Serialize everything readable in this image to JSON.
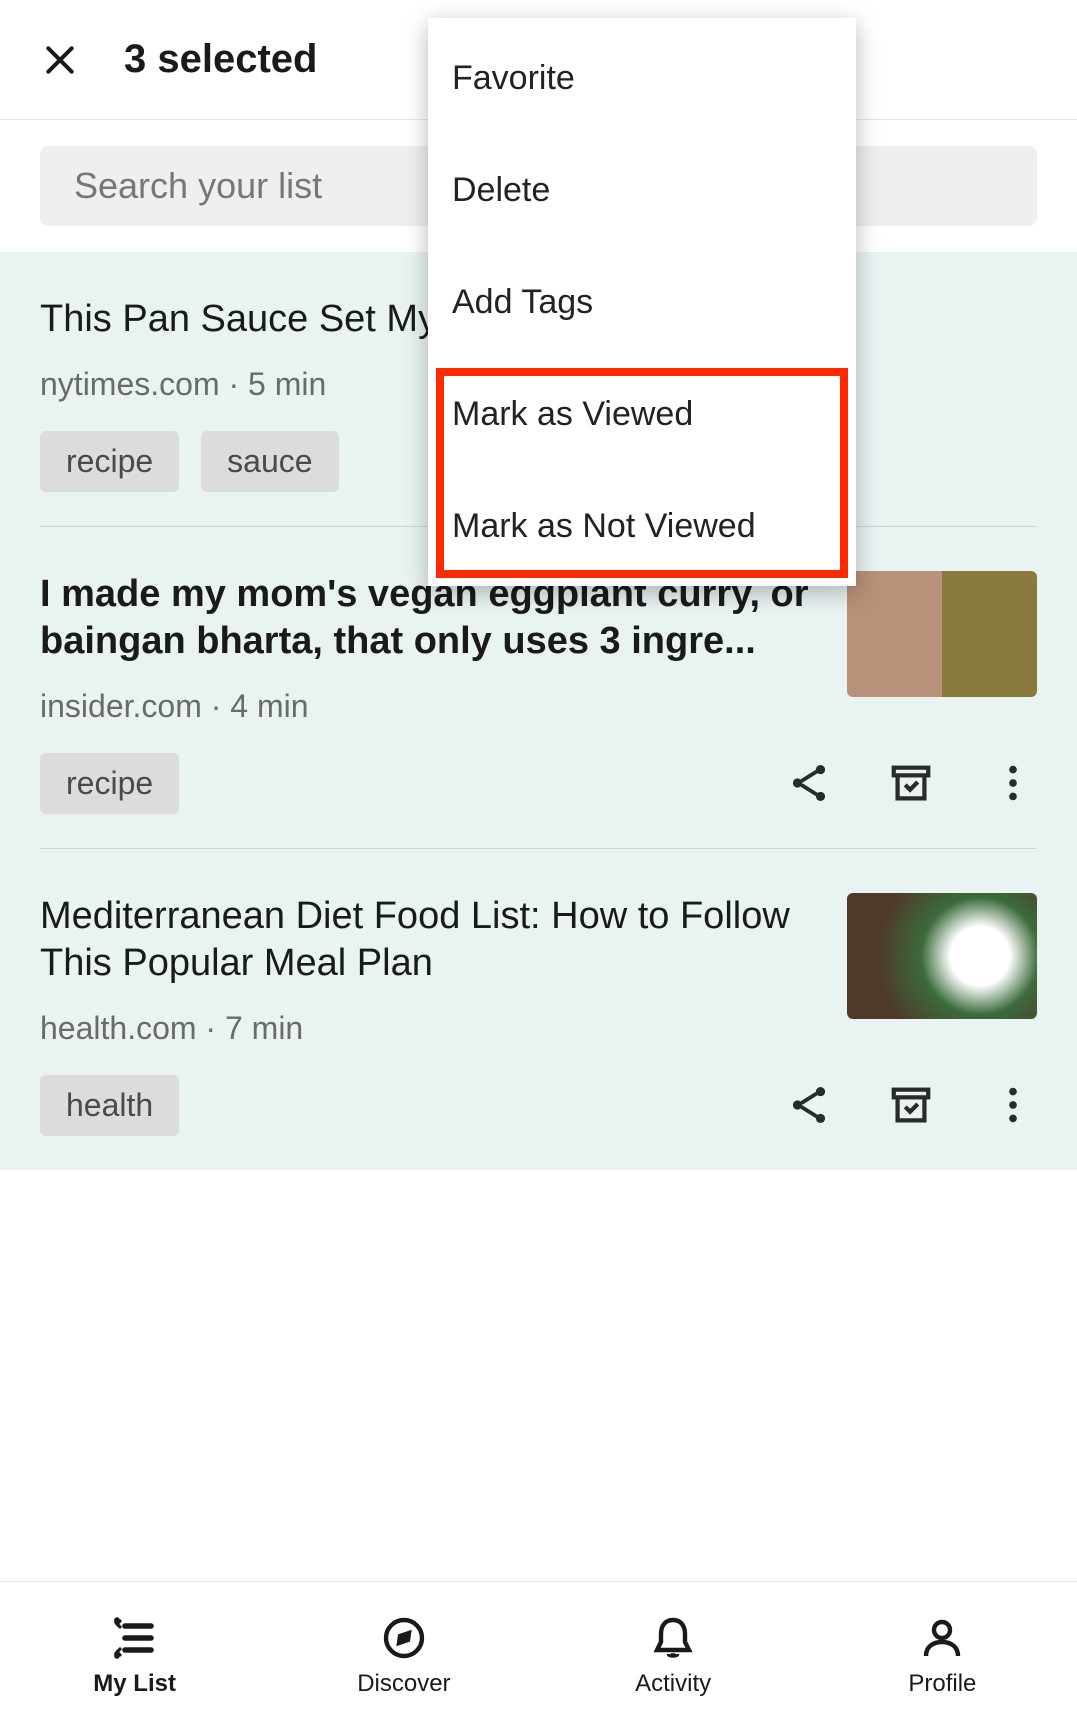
{
  "header": {
    "title": "3 selected"
  },
  "search": {
    "placeholder": "Search your list"
  },
  "menu": {
    "items": [
      {
        "label": "Favorite"
      },
      {
        "label": "Delete"
      },
      {
        "label": "Add Tags"
      },
      {
        "label": "Mark as Viewed"
      },
      {
        "label": "Mark as Not Viewed"
      }
    ]
  },
  "articles": [
    {
      "title": "This Pan Sauce Set My Chicken Free",
      "title_visible": "This Pan Sauce Set My C\nFree",
      "source": "nytimes.com",
      "time": "5 min",
      "bold": false,
      "tags": [
        "recipe",
        "sauce"
      ],
      "actions": false,
      "thumb": false
    },
    {
      "title": "I made my mom's vegan eggplant curry, or baingan bharta, that only uses 3 ingre...",
      "source": "insider.com",
      "time": "4 min",
      "bold": true,
      "tags": [
        "recipe"
      ],
      "actions": true,
      "thumb": "t2"
    },
    {
      "title": "Mediterranean Diet Food List: How to Follow This Popular Meal Plan",
      "source": "health.com",
      "time": "7 min",
      "bold": false,
      "tags": [
        "health"
      ],
      "actions": true,
      "thumb": "t3"
    }
  ],
  "nav": {
    "mylist": "My List",
    "discover": "Discover",
    "activity": "Activity",
    "profile": "Profile"
  }
}
